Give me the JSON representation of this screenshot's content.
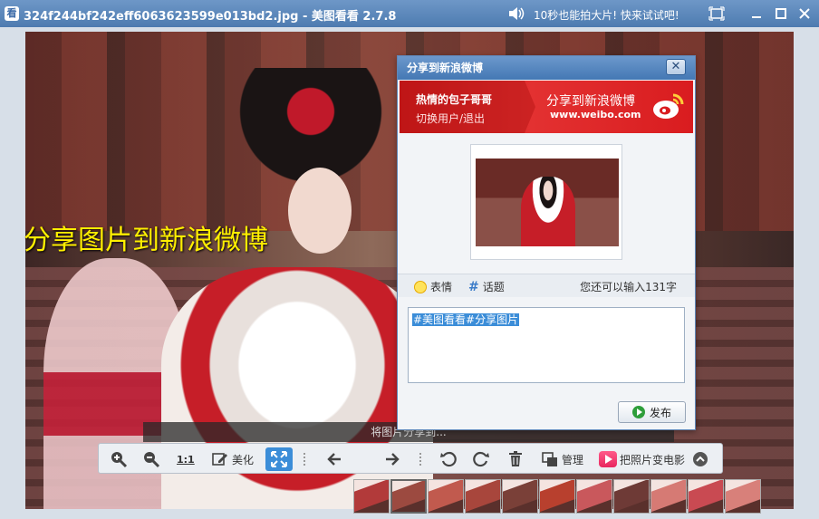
{
  "window": {
    "icon_char": "看",
    "title": "324f244bf242eff6063623599e013bd2.jpg - 美图看看 2.7.8",
    "promo": "10秒也能拍大片! 快来试试吧!"
  },
  "image": {
    "overlay_caption": "分享图片到新浪微博",
    "hint": "将图片分享到..."
  },
  "toolbar": {
    "one_to_one": "1:1",
    "beautify": "美化",
    "manage": "管理",
    "photo_to_movie": "把照片变电影"
  },
  "dialog": {
    "title": "分享到新浪微博",
    "close": "✕",
    "user_name": "热情的包子哥哥",
    "switch_user": "切换用户/退出",
    "share_title": "分享到新浪微博",
    "weibo_url": "www.weibo.com",
    "emoticon": "表情",
    "topic": "话题",
    "counter": "您还可以输入131字",
    "text_value": "#美图看看#分享图片",
    "publish": "发布"
  },
  "thumbnails": [
    {
      "selected": false,
      "color": "#b23a3a"
    },
    {
      "selected": true,
      "color": "#9c4a40"
    },
    {
      "selected": false,
      "color": "#c15a4e"
    },
    {
      "selected": false,
      "color": "#a8463c"
    },
    {
      "selected": false,
      "color": "#7a4038"
    },
    {
      "selected": false,
      "color": "#b8402e"
    },
    {
      "selected": false,
      "color": "#c9585c"
    },
    {
      "selected": false,
      "color": "#6e3a36"
    },
    {
      "selected": false,
      "color": "#d67a74"
    },
    {
      "selected": false,
      "color": "#c94a52"
    },
    {
      "selected": false,
      "color": "#d8807a"
    }
  ],
  "colors": {
    "accent": "#3b8dd8",
    "weibo_red": "#d91c1f",
    "caption_yellow": "#ffef00"
  }
}
